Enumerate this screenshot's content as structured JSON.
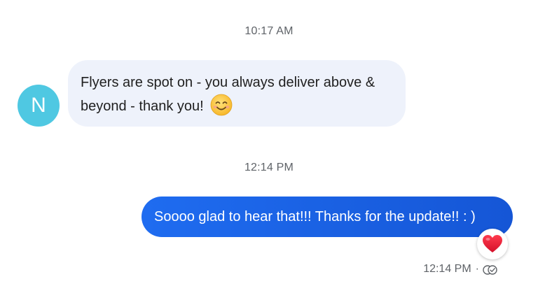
{
  "conversation": {
    "timestamp_1": "10:17 AM",
    "timestamp_2": "12:14 PM",
    "incoming": {
      "avatar_initial": "N",
      "avatar_color": "#4fc8e2",
      "text": "Flyers are spot on - you always deliver above & beyond - thank you!",
      "emoji": "smiling-face-emoji"
    },
    "outgoing": {
      "text": "Soooo glad to hear that!!! Thanks for the update!! : )",
      "reaction": "heart-icon",
      "time": "12:14 PM",
      "separator": "·",
      "status_icon": "read-receipt-icon"
    }
  },
  "colors": {
    "incoming_bubble": "#eef2fb",
    "outgoing_bubble": "#1f6cf0",
    "meta_text": "#5f6368"
  }
}
